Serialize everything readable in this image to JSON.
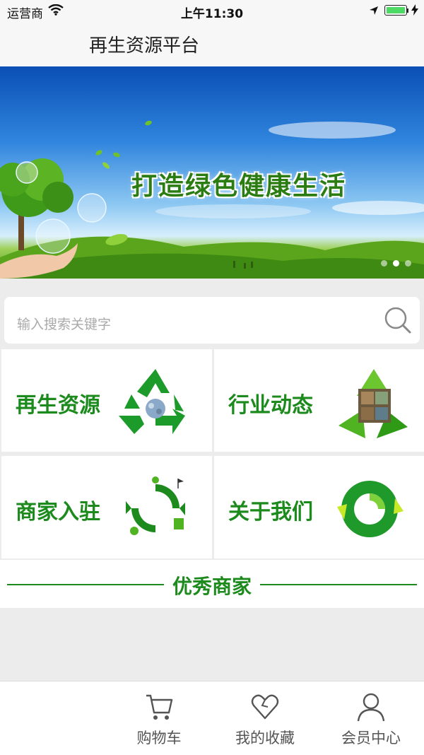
{
  "status_bar": {
    "carrier": "运营商",
    "time": "上午11:30"
  },
  "nav": {
    "title": "再生资源平台"
  },
  "banner": {
    "slogan": "打造绿色健康生活",
    "page_count": 3,
    "active_page": 2
  },
  "search": {
    "placeholder": "输入搜索关键字"
  },
  "grid": [
    {
      "label": "再生资源",
      "icon": "recycle-icon"
    },
    {
      "label": "行业动态",
      "icon": "recycle-photo-icon"
    },
    {
      "label": "商家入驻",
      "icon": "eco-cycle-icon"
    },
    {
      "label": "关于我们",
      "icon": "green-circle-icon"
    }
  ],
  "featured": {
    "title": "优秀商家"
  },
  "tabs": [
    {
      "label": "购物车",
      "icon": "cart-icon"
    },
    {
      "label": "我的收藏",
      "icon": "heart-icon"
    },
    {
      "label": "会员中心",
      "icon": "user-icon"
    }
  ],
  "colors": {
    "brand_green": "#1c8a1c",
    "accent_battery": "#4cd964"
  }
}
